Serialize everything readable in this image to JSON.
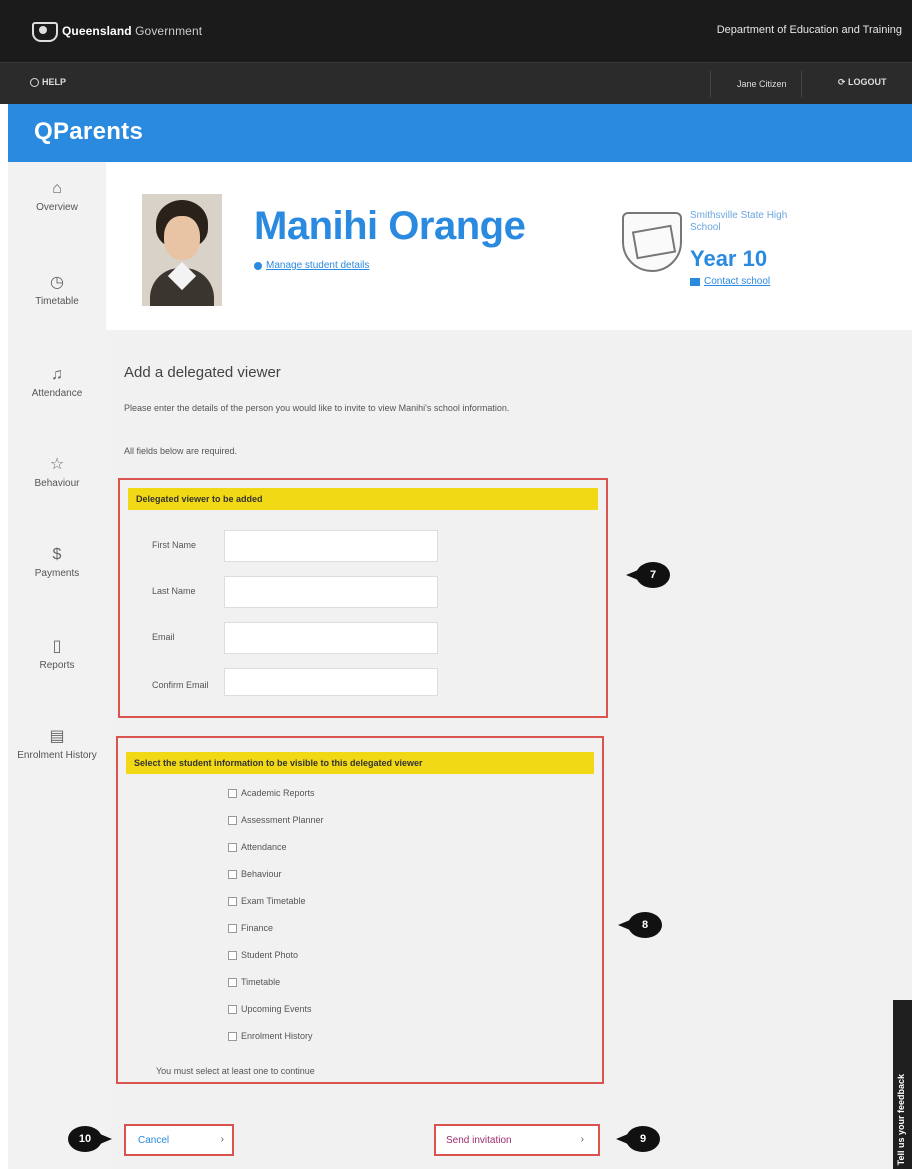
{
  "header": {
    "gov_name_bold": "Queensland",
    "gov_name_light": "Government",
    "department": "Department of Education and Training",
    "help": "HELP",
    "user": "Jane Citizen",
    "logout": "LOGOUT",
    "brand": "QParents"
  },
  "sidebar": {
    "items": [
      {
        "label": "Overview",
        "icon": "home-icon"
      },
      {
        "label": "Timetable",
        "icon": "clock-icon"
      },
      {
        "label": "Attendance",
        "icon": "bell-icon"
      },
      {
        "label": "Behaviour",
        "icon": "star-icon"
      },
      {
        "label": "Payments",
        "icon": "dollar-icon"
      },
      {
        "label": "Reports",
        "icon": "report-icon"
      },
      {
        "label": "Enrolment History",
        "icon": "history-icon"
      }
    ]
  },
  "profile": {
    "name": "Manihi Orange",
    "manage_link": "Manage student details",
    "school": "Smithsville State High School",
    "year": "Year 10",
    "contact_link": "Contact school"
  },
  "form": {
    "title": "Add a delegated viewer",
    "intro": "Please enter the details of the person you would like to invite to view Manihi's school information.",
    "required_note": "All fields below are required.",
    "section1_title": "Delegated viewer to be added",
    "fields": [
      {
        "label": "First Name"
      },
      {
        "label": "Last Name"
      },
      {
        "label": "Email"
      },
      {
        "label": "Confirm Email"
      }
    ],
    "section2_title": "Select the student information to be visible to this delegated viewer",
    "options": [
      "Academic Reports",
      "Assessment Planner",
      "Attendance",
      "Behaviour",
      "Exam Timetable",
      "Finance",
      "Student Photo",
      "Timetable",
      "Upcoming Events",
      "Enrolment History"
    ],
    "options_hint": "You must select at least one to continue",
    "cancel": "Cancel",
    "send": "Send invitation"
  },
  "callouts": [
    "7",
    "8",
    "9",
    "10"
  ],
  "feedback": "Tell us your feedback",
  "colors": {
    "brand_blue": "#2a8ae0",
    "highlight_yellow": "#f2d916",
    "annotation_red": "#d9534f"
  }
}
